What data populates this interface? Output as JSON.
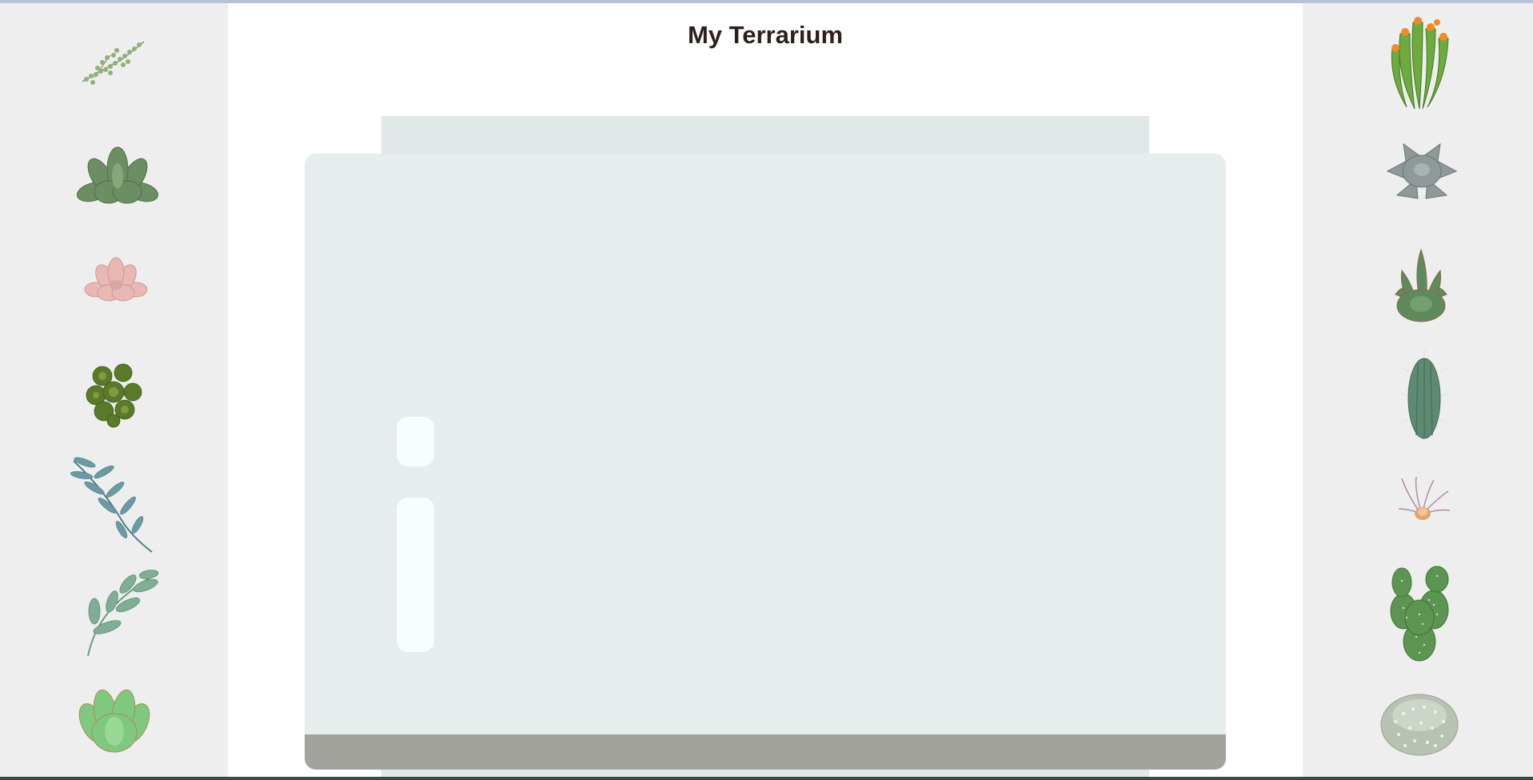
{
  "title": "My Terrarium",
  "colors": {
    "page_background": "#ffffff",
    "side_panel": "#eeeeee",
    "title_text": "#2e1f1c",
    "jar_lid": "#e0e9e7",
    "jar_body": "#e6eeed",
    "jar_glossy": "#f6fffd",
    "dirt": "#a3a39d"
  },
  "left_plants": [
    "string-of-pearls-plant-icon",
    "green-rosette-succulent-icon",
    "pink-rosette-succulent-icon",
    "dark-leafy-clover-plant-icon",
    "blue-eucalyptus-branch-icon",
    "sage-leaf-branch-icon",
    "jade-rosette-succulent-icon"
  ],
  "right_plants": [
    "flowering-finger-cactus-icon",
    "silver-echeveria-succulent-icon",
    "spiky-agave-succulent-icon",
    "columnar-cactus-icon",
    "air-plant-icon",
    "prickly-pear-cactus-icon",
    "fuzzy-ball-cactus-icon"
  ]
}
